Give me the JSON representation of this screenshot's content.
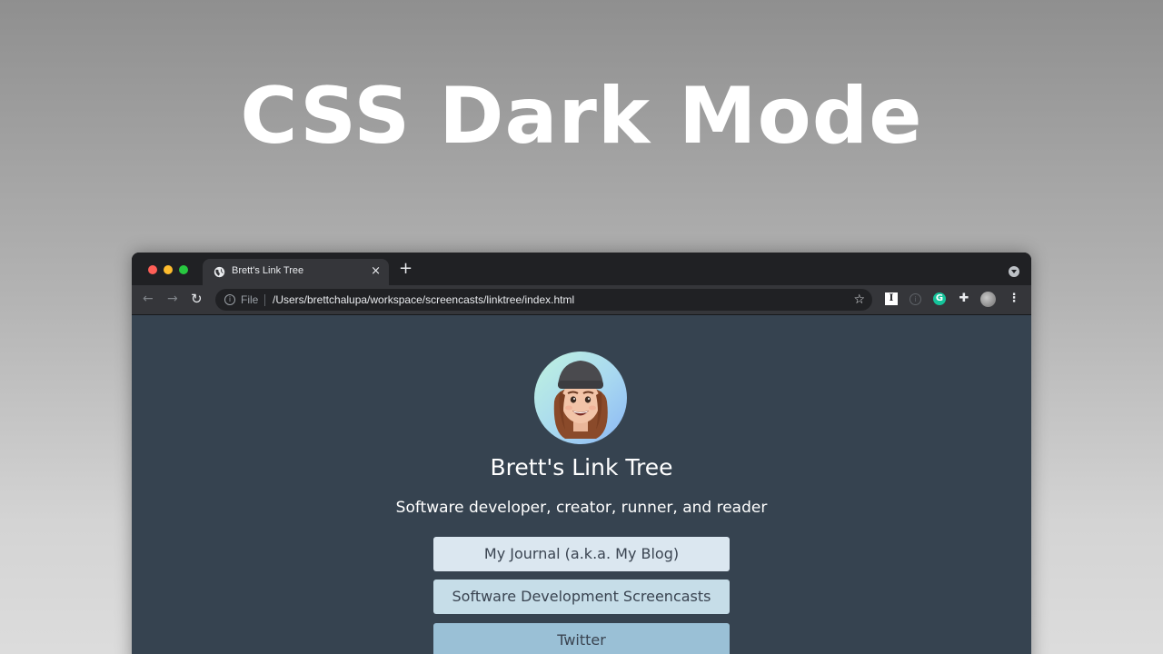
{
  "headline": "CSS Dark Mode",
  "browser": {
    "tab": {
      "title": "Brett's Link Tree",
      "close_symbol": "×",
      "favicon": "globe-icon"
    },
    "new_tab_symbol": "+",
    "toolbar": {
      "back_symbol": "←",
      "forward_symbol": "→",
      "reload_symbol": "↻",
      "url_scheme": "File",
      "url": "/Users/brettchalupa/workspace/screencasts/linktree/index.html",
      "star_symbol": "☆",
      "extensions": [
        "instapaper-icon",
        "info-icon",
        "grammarly-icon",
        "puzzle-icon",
        "profile-avatar"
      ],
      "instapaper_label": "I",
      "grammarly_label": "G",
      "puzzle_symbol": "✚",
      "menu_symbol": "⋮"
    }
  },
  "page": {
    "title": "Brett's Link Tree",
    "subtitle": "Software developer, creator, runner, and reader",
    "links": [
      {
        "label": "My Journal (a.k.a. My Blog)"
      },
      {
        "label": "Software Development Screencasts"
      },
      {
        "label": "Twitter"
      }
    ]
  },
  "colors": {
    "page_background": "#364350",
    "browser_chrome": "#202124",
    "toolbar": "#35363a",
    "link_1": "#dbe7f0",
    "link_2": "#c6dde8",
    "link_3": "#9ac0d6",
    "link_text": "#3a4451"
  }
}
